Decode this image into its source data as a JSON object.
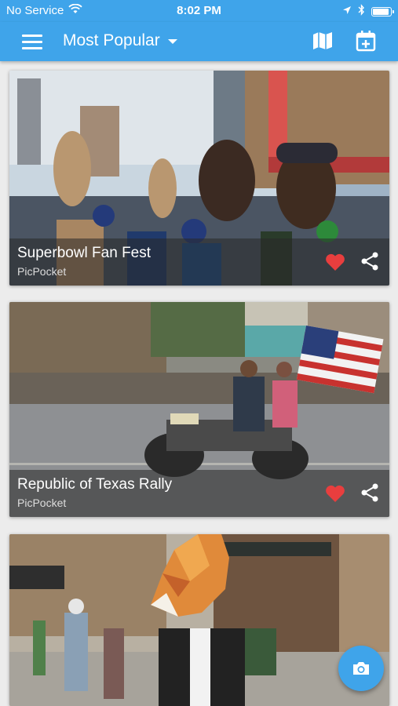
{
  "status_bar": {
    "carrier": "No Service",
    "time": "8:02 PM"
  },
  "app_bar": {
    "title": "Most Popular"
  },
  "feed": {
    "cards": [
      {
        "title": "Superbowl Fan Fest",
        "source": "PicPocket",
        "liked": true
      },
      {
        "title": "Republic of Texas Rally",
        "source": "PicPocket",
        "liked": true
      },
      {
        "title": "",
        "source": "",
        "liked": false
      }
    ]
  },
  "colors": {
    "primary": "#3fa4ea",
    "heart": "#e83e3e"
  },
  "icons": [
    "menu-icon",
    "dropdown-caret-icon",
    "map-icon",
    "add-event-icon",
    "heart-icon",
    "share-icon",
    "camera-icon",
    "wifi-icon",
    "location-icon",
    "bluetooth-icon",
    "battery-icon"
  ]
}
